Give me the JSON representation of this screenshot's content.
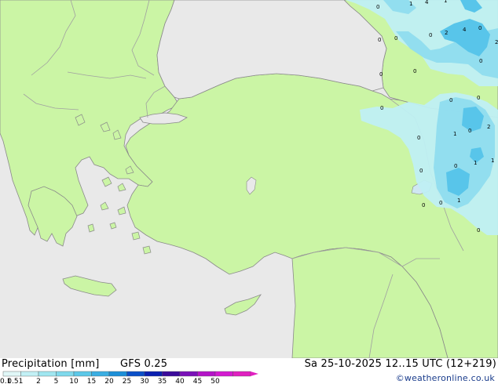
{
  "footer": {
    "title": "Precipitation [mm]",
    "model": "GFS 0.25",
    "datetime": "Sa 25-10-2025 12..15 UTC (12+219)",
    "credit": "©weatheronline.co.uk"
  },
  "legend": {
    "labels": [
      "0.1",
      "0.5",
      "1",
      "2",
      "5",
      "10",
      "15",
      "20",
      "25",
      "30",
      "35",
      "40",
      "45",
      "50"
    ],
    "colors": [
      "#e0f7f7",
      "#c2f0f5",
      "#a0e6f0",
      "#7fd9ec",
      "#5cc8e8",
      "#3aaee2",
      "#1c8fd8",
      "#0a4fc8",
      "#0a20b0",
      "#3a0a9a",
      "#7a10b8",
      "#b414c8",
      "#d41ad0",
      "#e020c0"
    ]
  },
  "map": {
    "colors": {
      "sea": "#e9e9e9",
      "land": "#cbf5a5",
      "coast": "#8a8a8a",
      "border": "#a0a0a0",
      "precip_light": "#bfeff3",
      "precip_mid": "#8fdcee",
      "precip_heavy": "#58c5ea"
    },
    "values": [
      "0",
      "1",
      "4",
      "1",
      "0",
      "2",
      "4",
      "0",
      "0",
      "0",
      "0",
      "0",
      "2",
      "0",
      "0",
      "0",
      "0",
      "1",
      "0",
      "2",
      "0",
      "1",
      "1",
      "0",
      "0",
      "0",
      "1",
      "0",
      "0"
    ]
  }
}
